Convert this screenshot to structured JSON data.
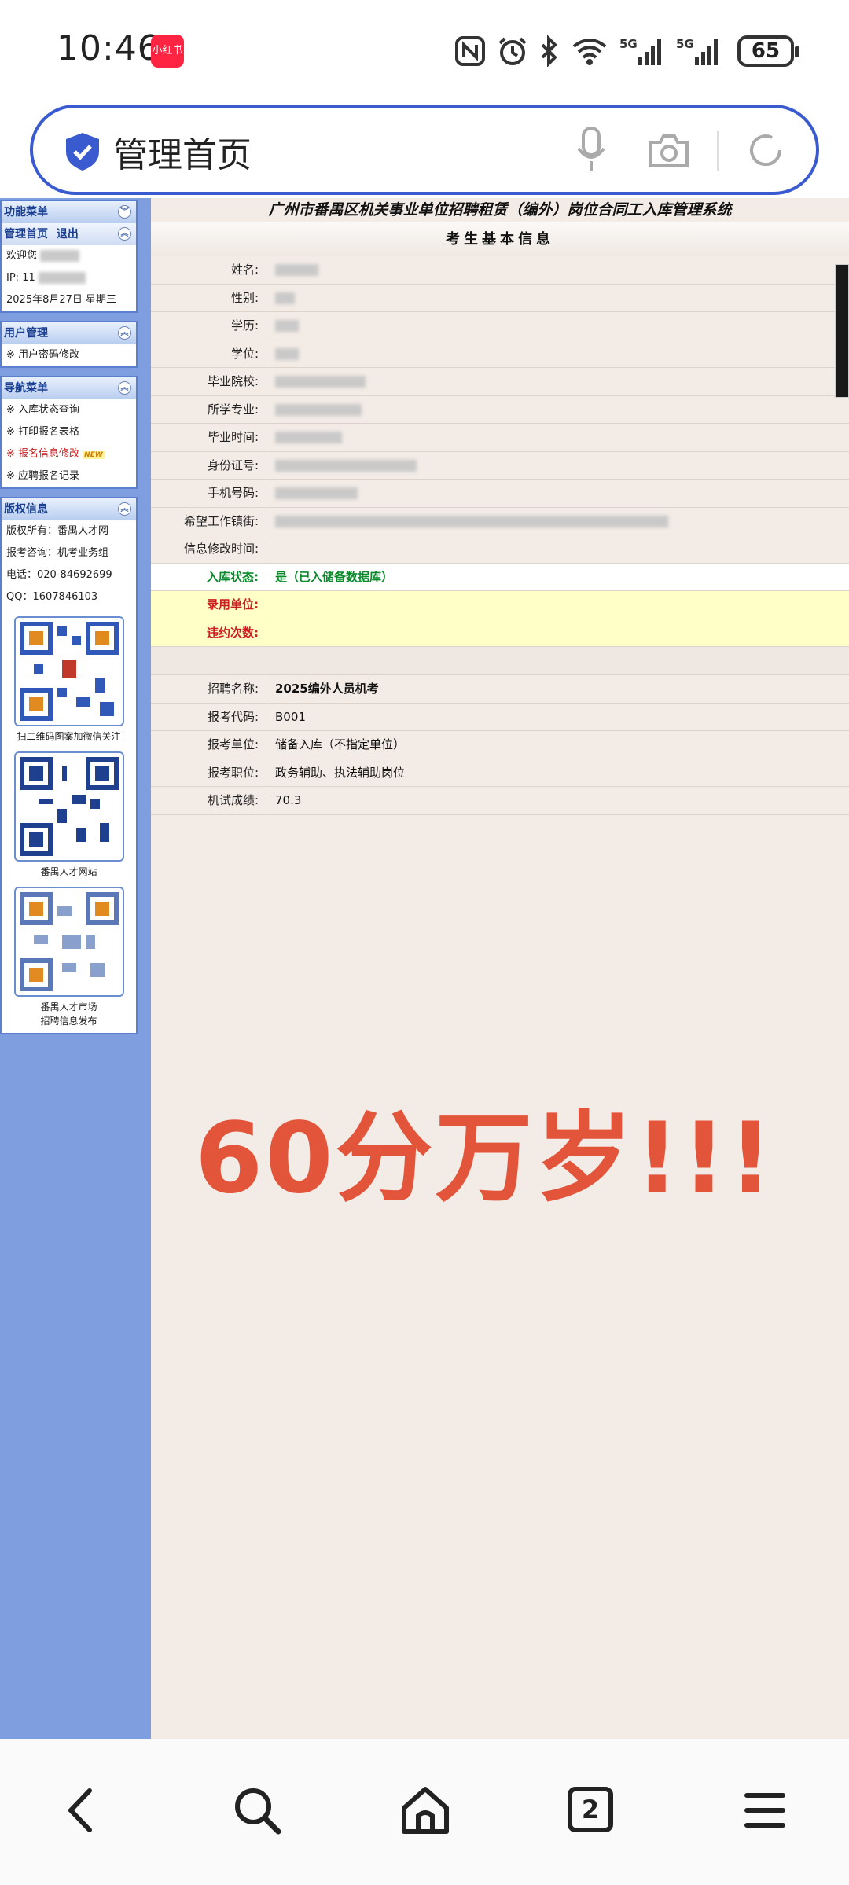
{
  "status_bar": {
    "time": "10:46",
    "app_badge": "小红书",
    "battery": "65"
  },
  "browser": {
    "page_title": "管理首页",
    "tab_count": "2"
  },
  "sidebar": {
    "function_menu": {
      "title": "功能菜单",
      "home": "管理首页",
      "logout": "退出",
      "welcome": "欢迎您",
      "ip": "IP: 11",
      "date": "2025年8月27日 星期三"
    },
    "user_mgmt": {
      "title": "用户管理",
      "items": [
        "※ 用户密码修改"
      ]
    },
    "nav_menu": {
      "title": "导航菜单",
      "items": [
        "※ 入库状态查询",
        "※ 打印报名表格",
        "※ 报名信息修改",
        "※ 应聘报名记录"
      ],
      "new_tag": "NEW"
    },
    "copyright": {
      "title": "版权信息",
      "owner": "版权所有：番禺人才网",
      "consult": "报考咨询：机考业务组",
      "phone": "电话：020-84692699",
      "qq": "QQ：1607846103"
    },
    "qr_captions": [
      "扫二维码图案加微信关注",
      "番禺人才网站",
      "番禺人才市场",
      "招聘信息发布"
    ]
  },
  "main": {
    "system_title": "广州市番禺区机关事业单位招聘租赁（编外）岗位合同工入库管理系统",
    "section_title": "考生基本信息",
    "info_labels": [
      "姓名:",
      "性别:",
      "学历:",
      "学位:",
      "毕业院校:",
      "所学专业:",
      "毕业时间:",
      "身份证号:",
      "手机号码:",
      "希望工作镇街:",
      "信息修改时间:"
    ],
    "status_label": "入库状态:",
    "status_value": "是（已入储备数据库）",
    "hire_unit_label": "录用单位:",
    "breach_label": "违约次数:",
    "exam": {
      "name_label": "招聘名称:",
      "name_value": "2025编外人员机考",
      "code_label": "报考代码:",
      "code_value": "B001",
      "unit_label": "报考单位:",
      "unit_value": "储备入库（不指定单位）",
      "position_label": "报考职位:",
      "position_value": "政务辅助、执法辅助岗位",
      "score_label": "机试成绩:",
      "score_value": "70.3"
    },
    "overlay_text": "60分万岁!!!"
  },
  "colors": {
    "accent_blue": "#3a5bd0",
    "sidebar_blue": "#7f9ee0",
    "status_green": "#0a8a2a",
    "label_red": "#cc2020",
    "overlay_red": "#e3553a"
  }
}
